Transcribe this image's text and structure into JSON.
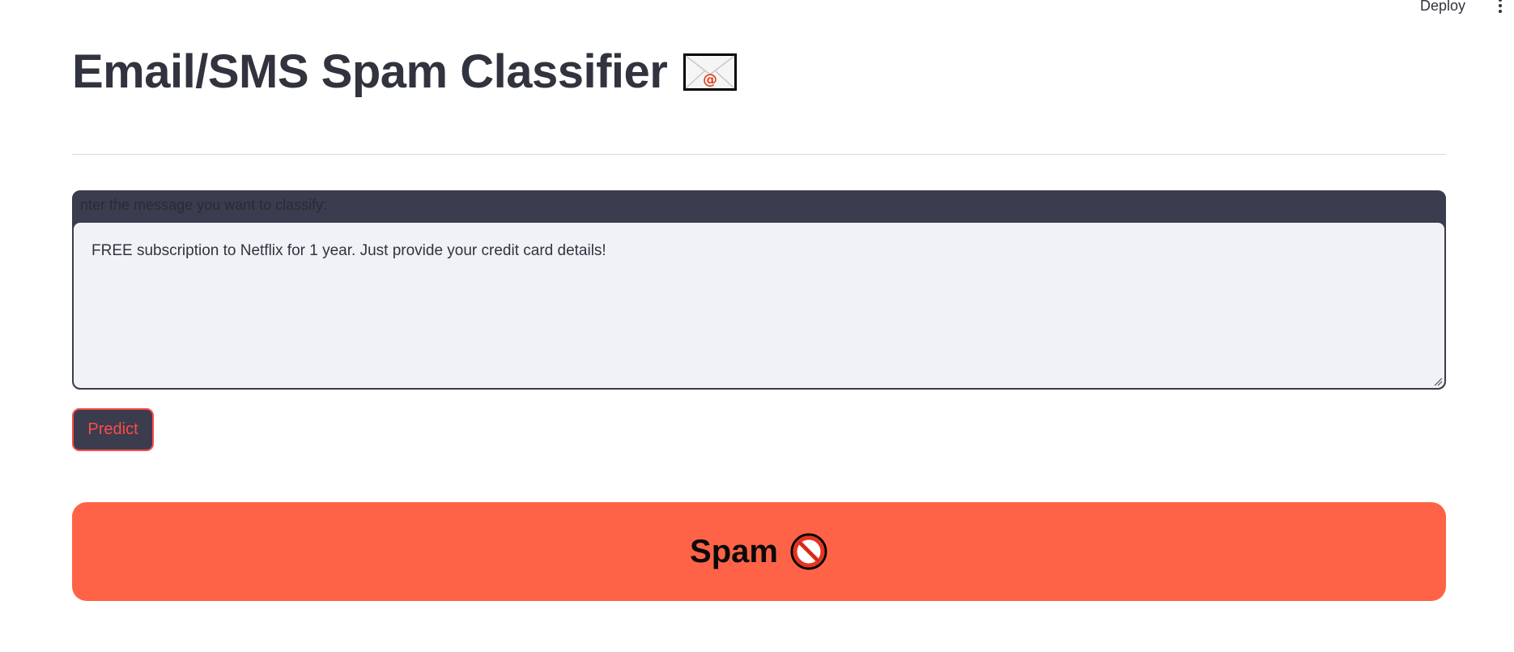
{
  "header": {
    "deploy_label": "Deploy",
    "menu_icon": "kebab-menu-icon"
  },
  "title": {
    "text": "Email/SMS Spam Classifier",
    "icon": "envelope-icon"
  },
  "input": {
    "label": "nter the message you want to classify:",
    "value": "FREE subscription to Netflix for 1 year. Just provide your credit card details!"
  },
  "predict_button": {
    "label": "Predict"
  },
  "result": {
    "label": "Spam",
    "icon": "no-entry-icon",
    "color": "#ff6347"
  },
  "colors": {
    "accent": "#ff4b4b",
    "dark": "#3b3c4d",
    "text": "#31333f",
    "input_bg": "#f0f2f6"
  }
}
